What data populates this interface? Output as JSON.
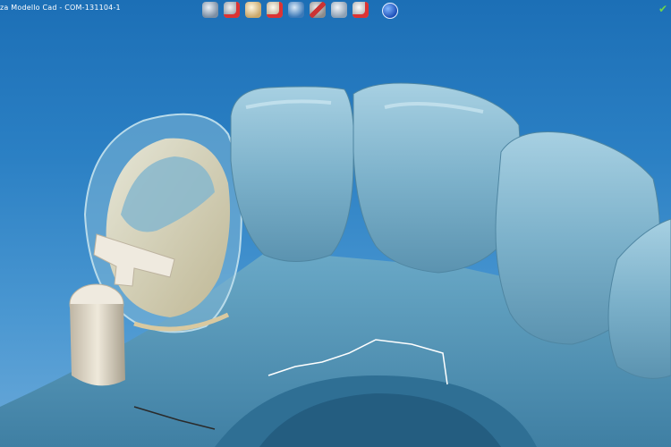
{
  "window": {
    "title": "za Modello Cad  - COM-131104-1"
  },
  "toolbar": {
    "tools": [
      {
        "icon": "model-view-icon"
      },
      {
        "icon": "model-delete-icon"
      },
      {
        "icon": "crown-add-icon"
      },
      {
        "icon": "crown-delete-icon"
      },
      {
        "icon": "model-edit-icon"
      },
      {
        "icon": "cut-tool-icon"
      },
      {
        "icon": "layer-remove-icon"
      },
      {
        "icon": "abutment-delete-icon"
      }
    ],
    "power_icon": "power-icon"
  },
  "status": {
    "confirm_icon": "checkmark-icon",
    "confirm_color": "#6fd44a"
  },
  "colors": {
    "background_top": "#1c6fb6",
    "teeth": "#7fb3cc",
    "crown_core": "#e8dcc0",
    "abutment": "#ddd6c8"
  }
}
